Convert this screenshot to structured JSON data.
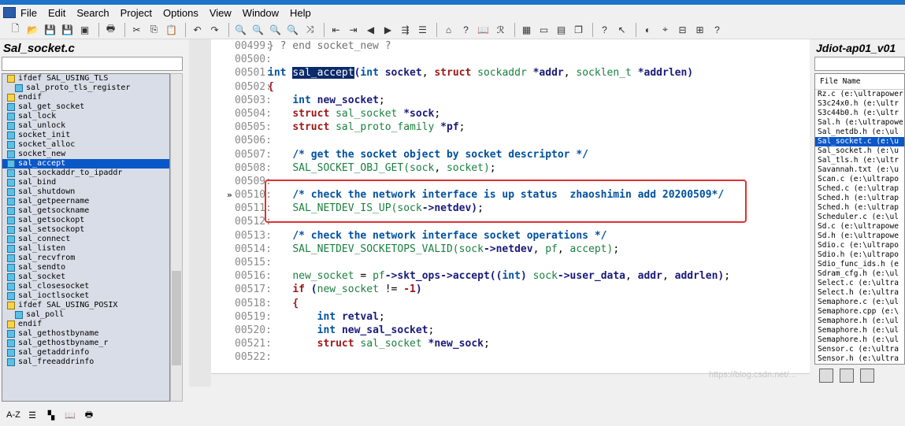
{
  "menu": [
    "File",
    "Edit",
    "Search",
    "Project",
    "Options",
    "View",
    "Window",
    "Help"
  ],
  "left_panel": {
    "title": "Sal_socket.c",
    "symbols": [
      {
        "label": "ifdef SAL_USING_TLS",
        "icon": "hash"
      },
      {
        "label": "sal_proto_tls_register",
        "icon": "func",
        "indent": true
      },
      {
        "label": "endif",
        "icon": "hash"
      },
      {
        "label": "sal_get_socket",
        "icon": "func"
      },
      {
        "label": "sal_lock",
        "icon": "func"
      },
      {
        "label": "sal_unlock",
        "icon": "func"
      },
      {
        "label": "socket_init",
        "icon": "func"
      },
      {
        "label": "socket_alloc",
        "icon": "func"
      },
      {
        "label": "socket_new",
        "icon": "func"
      },
      {
        "label": "sal_accept",
        "icon": "func",
        "selected": true
      },
      {
        "label": "sal_sockaddr_to_ipaddr",
        "icon": "func"
      },
      {
        "label": "sal_bind",
        "icon": "func"
      },
      {
        "label": "sal_shutdown",
        "icon": "func"
      },
      {
        "label": "sal_getpeername",
        "icon": "func"
      },
      {
        "label": "sal_getsockname",
        "icon": "func"
      },
      {
        "label": "sal_getsockopt",
        "icon": "func"
      },
      {
        "label": "sal_setsockopt",
        "icon": "func"
      },
      {
        "label": "sal_connect",
        "icon": "func"
      },
      {
        "label": "sal_listen",
        "icon": "func"
      },
      {
        "label": "sal_recvfrom",
        "icon": "func"
      },
      {
        "label": "sal_sendto",
        "icon": "func"
      },
      {
        "label": "sal_socket",
        "icon": "func"
      },
      {
        "label": "sal_closesocket",
        "icon": "func"
      },
      {
        "label": "sal_ioctlsocket",
        "icon": "func"
      },
      {
        "label": "ifdef SAL_USING_POSIX",
        "icon": "hash"
      },
      {
        "label": "sal_poll",
        "icon": "func",
        "indent": true
      },
      {
        "label": "endif",
        "icon": "hash"
      },
      {
        "label": "sal_gethostbyname",
        "icon": "func"
      },
      {
        "label": "sal_gethostbyname_r",
        "icon": "func"
      },
      {
        "label": "sal_getaddrinfo",
        "icon": "func"
      },
      {
        "label": "sal_freeaddrinfo",
        "icon": "func"
      }
    ],
    "sort_label": "A-Z"
  },
  "code_lines": [
    {
      "num": "00499:",
      "html": "<span class=\"gr\">} ? end socket_new ?</span>"
    },
    {
      "num": "00500:",
      "html": ""
    },
    {
      "num": "00501:",
      "html": "<span class=\"ty\">int</span> <span class=\"hl\">sal_accept</span><span class=\"id\">(</span><span class=\"ty\">int</span> <span class=\"id\">socket</span>, <span class=\"kw\">struct</span> <span class=\"fn\">sockaddr</span> <span class=\"id\">*addr</span>, <span class=\"fn\">socklen_t</span> <span class=\"id\">*addrlen)</span>"
    },
    {
      "num": "00502:",
      "html": "<span class=\"kw\">{</span>"
    },
    {
      "num": "00503:",
      "html": "    <span class=\"ty\">int</span> <span class=\"id\">new_socket</span>;"
    },
    {
      "num": "00504:",
      "html": "    <span class=\"kw\">struct</span> <span class=\"fn\">sal_socket</span> <span class=\"id\">*sock</span>;"
    },
    {
      "num": "00505:",
      "html": "    <span class=\"kw\">struct</span> <span class=\"fn\">sal_proto_family</span> <span class=\"id\">*pf</span>;"
    },
    {
      "num": "00506:",
      "html": ""
    },
    {
      "num": "00507:",
      "html": "    <span class=\"cm\">/* get the socket object by socket descriptor */</span>"
    },
    {
      "num": "00508:",
      "html": "    <span class=\"fn\">SAL_SOCKET_OBJ_GET(sock</span>, <span class=\"fn\">socket)</span>;"
    },
    {
      "num": "00509:",
      "html": ""
    },
    {
      "num": "00510:",
      "html": "    <span class=\"cm\">/* check the network interface is up status  zhaoshimin add 20200509*/</span>",
      "mark": "»"
    },
    {
      "num": "00511:",
      "html": "    <span class=\"fn\">SAL_NETDEV_IS_UP(sock</span><span class=\"id\">-&gt;netdev)</span>;"
    },
    {
      "num": "00512:",
      "html": ""
    },
    {
      "num": "00513:",
      "html": "    <span class=\"cm\">/* check the network interface socket operations */</span>"
    },
    {
      "num": "00514:",
      "html": "    <span class=\"fn\">SAL_NETDEV_SOCKETOPS_VALID(sock</span><span class=\"id\">-&gt;netdev</span>, <span class=\"fn\">pf</span>, <span class=\"fn\">accept)</span>;"
    },
    {
      "num": "00515:",
      "html": ""
    },
    {
      "num": "00516:",
      "html": "    <span class=\"fn\">new_socket</span> = <span class=\"fn\">pf</span><span class=\"id\">-&gt;skt_ops-&gt;accept((</span><span class=\"ty\">int</span><span class=\"id\">)</span> <span class=\"fn\">sock</span><span class=\"id\">-&gt;user_data</span>, <span class=\"id\">addr</span>, <span class=\"id\">addrlen)</span>;"
    },
    {
      "num": "00517:",
      "html": "    <span class=\"kw\">if</span> <span class=\"id\">(</span><span class=\"fn\">new_socket</span> != <span class=\"kw\">-1</span><span class=\"id\">)</span>"
    },
    {
      "num": "00518:",
      "html": "    <span class=\"kw\">{</span>"
    },
    {
      "num": "00519:",
      "html": "        <span class=\"ty\">int</span> <span class=\"id\">retval</span>;"
    },
    {
      "num": "00520:",
      "html": "        <span class=\"ty\">int</span> <span class=\"id\">new_sal_socket</span>;"
    },
    {
      "num": "00521:",
      "html": "        <span class=\"kw\">struct</span> <span class=\"fn\">sal_socket</span> <span class=\"id\">*new_sock</span>;"
    },
    {
      "num": "00522:",
      "html": ""
    }
  ],
  "right_panel": {
    "title": "Jdiot-ap01_v01",
    "header": "File Name",
    "files": [
      {
        "label": "Rz.c (e:\\ultrapower"
      },
      {
        "label": "S3c24x0.h (e:\\ultr"
      },
      {
        "label": "S3c44b0.h (e:\\ultr"
      },
      {
        "label": "Sal.h (e:\\ultrapowe"
      },
      {
        "label": "Sal_netdb.h (e:\\ul"
      },
      {
        "label": "Sal_socket.c (e:\\u",
        "selected": true
      },
      {
        "label": "Sal_socket.h (e:\\u"
      },
      {
        "label": "Sal_tls.h (e:\\ultr"
      },
      {
        "label": "Savannah.txt (e:\\u"
      },
      {
        "label": "Scan.c (e:\\ultrapo"
      },
      {
        "label": "Sched.c (e:\\ultrap"
      },
      {
        "label": "Sched.h (e:\\ultrap"
      },
      {
        "label": "Sched.h (e:\\ultrap"
      },
      {
        "label": "Scheduler.c (e:\\ul"
      },
      {
        "label": "Sd.c (e:\\ultrapowe"
      },
      {
        "label": "Sd.h (e:\\ultrapowe"
      },
      {
        "label": "Sdio.c (e:\\ultrapo"
      },
      {
        "label": "Sdio.h (e:\\ultrapo"
      },
      {
        "label": "Sdio_func_ids.h (e"
      },
      {
        "label": "Sdram_cfg.h (e:\\ul"
      },
      {
        "label": "Select.c (e:\\ultra"
      },
      {
        "label": "Select.h (e:\\ultra"
      },
      {
        "label": "Semaphore.c (e:\\ul"
      },
      {
        "label": "Semaphore.cpp (e:\\"
      },
      {
        "label": "Semaphore.h (e:\\ul"
      },
      {
        "label": "Semaphore.h (e:\\ul"
      },
      {
        "label": "Semaphore.h (e:\\ul"
      },
      {
        "label": "Sensor.c (e:\\ultra"
      },
      {
        "label": "Sensor.h (e:\\ultra"
      }
    ]
  },
  "watermark": "https://blog.csdn.net/..."
}
